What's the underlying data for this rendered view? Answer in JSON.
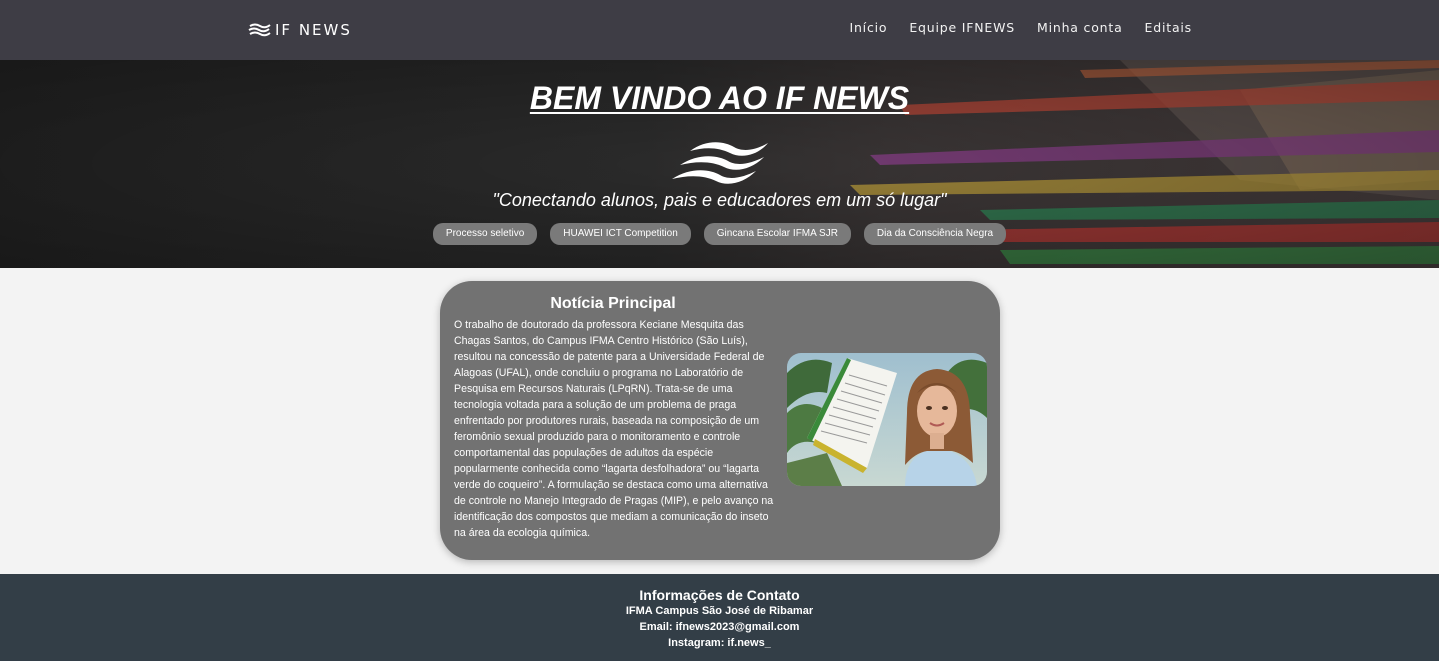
{
  "nav": {
    "brand": "IF NEWS",
    "links": [
      {
        "label": "Início"
      },
      {
        "label": "Equipe IFNEWS"
      },
      {
        "label": "Minha conta"
      },
      {
        "label": "Editais"
      }
    ]
  },
  "hero": {
    "title": "BEM VINDO AO IF NEWS",
    "tagline": "\"Conectando alunos, pais e educadores em um só lugar\"",
    "pills": [
      {
        "label": "Processo seletivo"
      },
      {
        "label": "HUAWEI ICT Competition"
      },
      {
        "label": "Gincana Escolar IFMA SJR"
      },
      {
        "label": "Dia da Consciência Negra"
      }
    ]
  },
  "main_news": {
    "title": "Notícia Principal",
    "body": "O trabalho de doutorado da professora Keciane Mesquita das Chagas Santos, do Campus IFMA Centro Histórico (São Luís), resultou na concessão de patente para a Universidade Federal de Alagoas (UFAL), onde concluiu o programa no Laboratório de Pesquisa em Recursos Naturais (LPqRN). Trata-se de uma tecnologia voltada para a solução de um problema de praga enfrentado por produtores rurais, baseada na composição de um feromônio sexual produzido para o monitoramento e controle comportamental das populações de adultos da espécie popularmente conhecida como “lagarta desfolhadora” ou “lagarta verde do coqueiro”. A formulação se destaca como uma alternativa de controle no Manejo Integrado de Pragas (MIP), e pelo avanço na identificação dos compostos que mediam a comunicação do inseto na área da ecologia química."
  },
  "footer": {
    "title": "Informações de Contato",
    "campus": "IFMA Campus São José de Ribamar",
    "email": "Email: ifnews2023@gmail.com",
    "instagram": "Instagram: if.news_"
  }
}
